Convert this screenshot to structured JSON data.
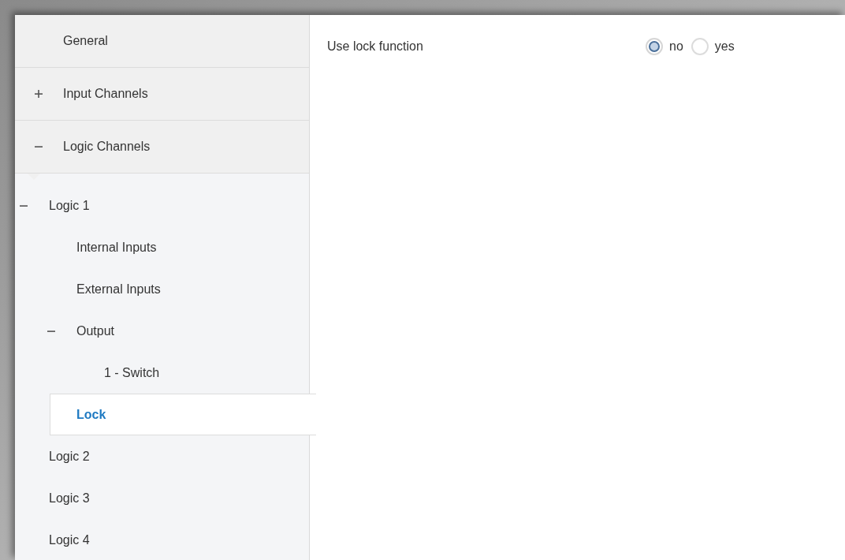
{
  "sections": [
    {
      "label": "General",
      "kind": "leaf"
    },
    {
      "label": "Input Channels",
      "kind": "group",
      "expanded": false
    },
    {
      "label": "Logic Channels",
      "kind": "group",
      "expanded": true
    }
  ],
  "tree": [
    {
      "label": "Logic 1",
      "kind": "group",
      "expanded": true,
      "selected": false,
      "children": [
        {
          "label": "Internal Inputs",
          "kind": "leaf",
          "selected": false
        },
        {
          "label": "External Inputs",
          "kind": "leaf",
          "selected": false
        },
        {
          "label": "Output",
          "kind": "group",
          "expanded": true,
          "selected": false,
          "children": [
            {
              "label": "1 - Switch",
              "kind": "leaf",
              "selected": false
            }
          ]
        },
        {
          "label": "Lock",
          "kind": "leaf",
          "selected": true
        }
      ]
    },
    {
      "label": "Logic 2",
      "kind": "leaf",
      "selected": false
    },
    {
      "label": "Logic 3",
      "kind": "leaf",
      "selected": false
    },
    {
      "label": "Logic 4",
      "kind": "leaf",
      "selected": false
    }
  ],
  "settings": [
    {
      "label": "Use lock function",
      "options": [
        {
          "label": "no",
          "selected": true
        },
        {
          "label": "yes",
          "selected": false
        }
      ]
    }
  ]
}
